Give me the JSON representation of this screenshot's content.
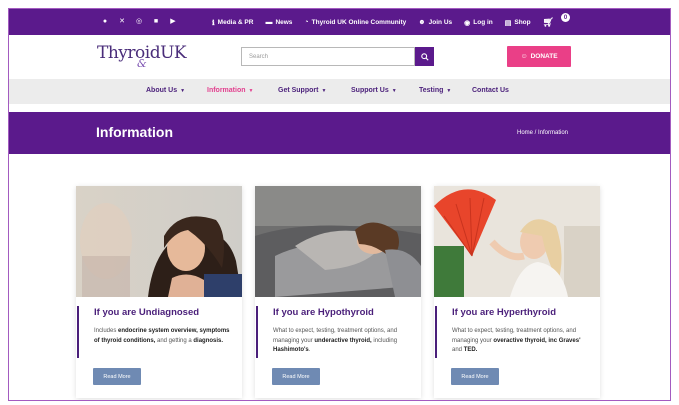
{
  "topbar": {
    "social_icons": [
      "facebook-icon",
      "x-icon",
      "instagram-icon",
      "linkedin-icon",
      "youtube-icon"
    ],
    "links": [
      {
        "icon": "info-icon",
        "label": "Media & PR"
      },
      {
        "icon": "newspaper-icon",
        "label": "News"
      },
      {
        "icon": "chat-icon",
        "label": "Thyroid UK Online Community"
      },
      {
        "icon": "people-icon",
        "label": "Join Us"
      },
      {
        "icon": "user-icon",
        "label": "Log in"
      },
      {
        "icon": "shop-icon",
        "label": "Shop"
      }
    ],
    "cart_count": "0"
  },
  "header": {
    "logo_text": "Thyroid",
    "logo_amp": "&",
    "logo_uk": "UK",
    "search_placeholder": "Search",
    "donate_label": "DONATE"
  },
  "nav": {
    "items": [
      {
        "label": "About Us",
        "has_dropdown": true
      },
      {
        "label": "Information",
        "has_dropdown": true,
        "active": true
      },
      {
        "label": "Get Support",
        "has_dropdown": true
      },
      {
        "label": "Support Us",
        "has_dropdown": true
      },
      {
        "label": "Testing",
        "has_dropdown": true
      },
      {
        "label": "Contact Us",
        "has_dropdown": false
      }
    ]
  },
  "banner": {
    "title": "Information",
    "breadcrumb": "Home / Information"
  },
  "cards": [
    {
      "title": "If you are Undiagnosed",
      "text_parts": [
        {
          "t": "Includes ",
          "b": false
        },
        {
          "t": "endocrine system overview, symptoms of thyroid conditions,",
          "b": true
        },
        {
          "t": " and getting a ",
          "b": false
        },
        {
          "t": "diagnosis.",
          "b": true
        }
      ],
      "button": "Read More"
    },
    {
      "title": "If you are Hypothyroid",
      "text_parts": [
        {
          "t": "What to expect, testing, treatment options, and managing your ",
          "b": false
        },
        {
          "t": "underactive thyroid,",
          "b": true
        },
        {
          "t": " including ",
          "b": false
        },
        {
          "t": "Hashimoto's",
          "b": true
        },
        {
          "t": ".",
          "b": false
        }
      ],
      "button": "Read More"
    },
    {
      "title": "If you are Hyperthyroid",
      "text_parts": [
        {
          "t": "What to expect, testing, treatment options, and managing your ",
          "b": false
        },
        {
          "t": "overactive thyroid, inc Graves'",
          "b": true
        },
        {
          "t": " and ",
          "b": false
        },
        {
          "t": "TED.",
          "b": true
        }
      ],
      "button": "Read More"
    }
  ],
  "colors": {
    "brand_purple": "#5b1a8c",
    "accent_pink": "#e23f8e",
    "donate_pink": "#ea3f87",
    "button_blue": "#6f8ab3"
  }
}
